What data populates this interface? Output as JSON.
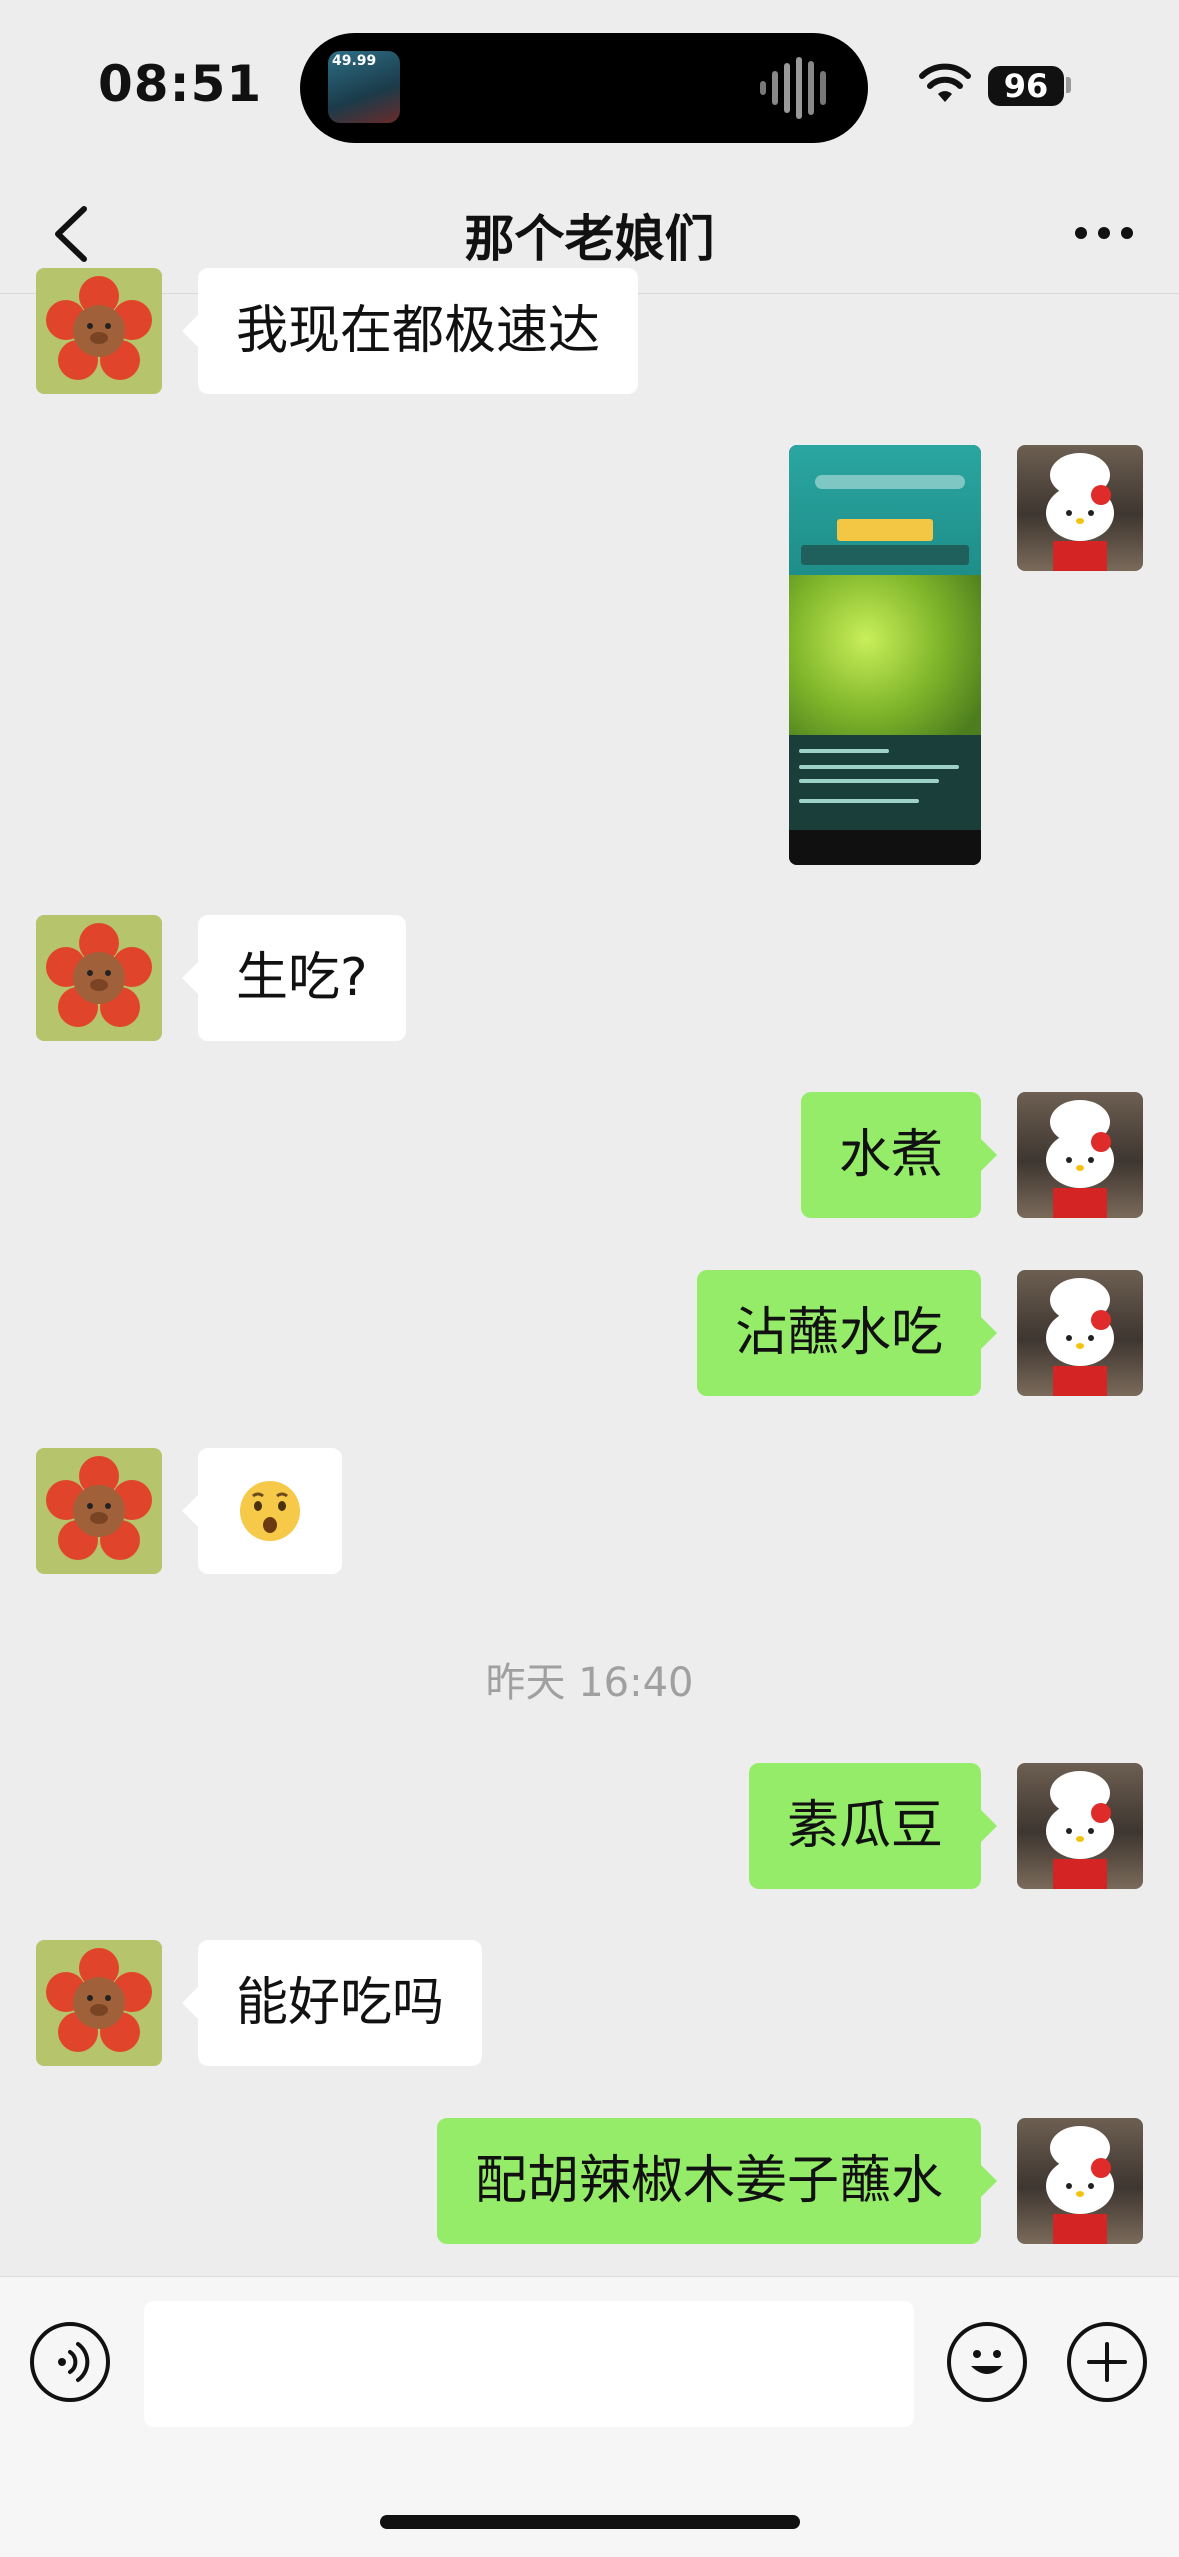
{
  "status_bar": {
    "time": "08:51",
    "island_art_label": "49.99",
    "battery": "96"
  },
  "nav": {
    "title": "那个老娘们",
    "back_icon": "chevron-left-icon",
    "more_icon": "ellipsis-icon"
  },
  "messages": [
    {
      "side": "left",
      "type": "text",
      "text": "我现在都极速达"
    },
    {
      "side": "right",
      "type": "image",
      "description_icon": "screenshot-thumbnail"
    },
    {
      "side": "left",
      "type": "text",
      "text": "生吃?"
    },
    {
      "side": "right",
      "type": "text",
      "text": "水煮"
    },
    {
      "side": "right",
      "type": "text",
      "text": "沾蘸水吃"
    },
    {
      "side": "left",
      "type": "text",
      "text": "😲"
    },
    {
      "side": "right",
      "type": "text",
      "text": "素瓜豆"
    },
    {
      "side": "left",
      "type": "text",
      "text": "能好吃吗"
    },
    {
      "side": "right",
      "type": "text",
      "text": "配胡辣椒木姜子蘸水"
    }
  ],
  "timestamp": "昨天 16:40",
  "input": {
    "placeholder": "",
    "voice_icon": "voice-icon",
    "emoji_icon": "emoji-icon",
    "plus_icon": "plus-icon"
  },
  "colors": {
    "bubble_sent": "#95ec69",
    "bubble_received": "#ffffff",
    "background": "#ededed"
  }
}
